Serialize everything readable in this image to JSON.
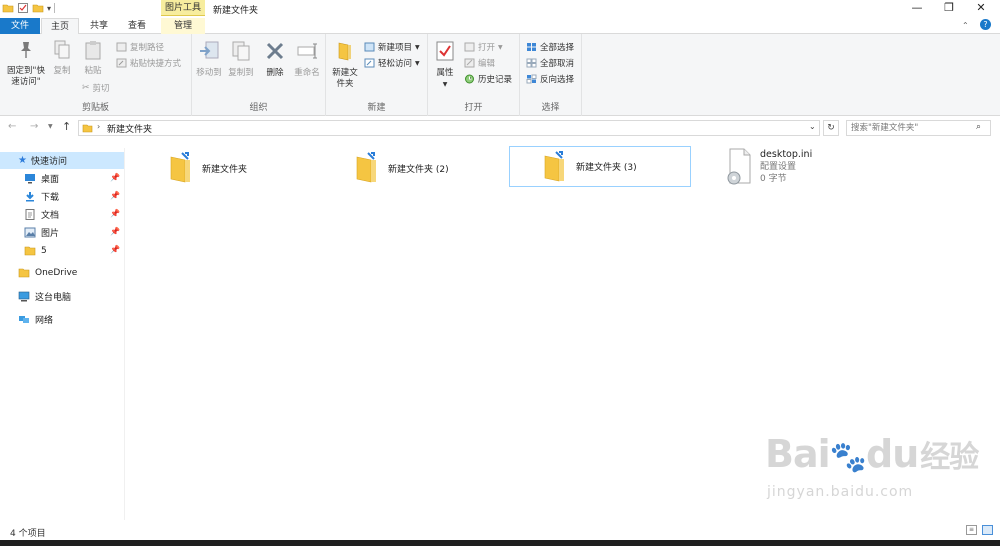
{
  "window": {
    "title": "新建文件夹",
    "contextual_tab": "图片工具"
  },
  "tabs": {
    "file": "文件",
    "home": "主页",
    "share": "共享",
    "view": "查看",
    "manage": "管理"
  },
  "ribbon": {
    "clipboard": {
      "label": "剪贴板",
      "pin": "固定到\"快速访问\"",
      "copy": "复制",
      "paste": "粘贴",
      "copy_path": "复制路径",
      "paste_shortcut": "粘贴快捷方式",
      "cut": "剪切"
    },
    "organize": {
      "label": "组织",
      "move_to": "移动到",
      "copy_to": "复制到",
      "delete": "删除",
      "rename": "重命名"
    },
    "new": {
      "label": "新建",
      "new_folder": "新建文件夹",
      "new_item": "新建项目",
      "easy_access": "轻松访问"
    },
    "open": {
      "label": "打开",
      "properties": "属性",
      "open": "打开",
      "edit": "编辑",
      "history": "历史记录"
    },
    "select": {
      "label": "选择",
      "select_all": "全部选择",
      "select_none": "全部取消",
      "invert": "反向选择"
    }
  },
  "address": {
    "path": "新建文件夹",
    "search_placeholder": "搜索\"新建文件夹\""
  },
  "nav": {
    "quick_access": "快速访问",
    "desktop": "桌面",
    "downloads": "下载",
    "documents": "文档",
    "pictures": "图片",
    "five": "5",
    "onedrive": "OneDrive",
    "this_pc": "这台电脑",
    "network": "网络"
  },
  "files": [
    {
      "name": "新建文件夹"
    },
    {
      "name": "新建文件夹 (2)"
    },
    {
      "name": "新建文件夹 (3)"
    },
    {
      "name": "desktop.ini",
      "type": "配置设置",
      "size": "0 字节"
    }
  ],
  "status": {
    "count": "4 个项目"
  },
  "watermark": {
    "brand_a": "Bai",
    "brand_b": "du",
    "brand_cn": "经验",
    "url": "jingyan.baidu.com"
  },
  "colors": {
    "accent": "#1979ca",
    "folder": "#f5c542",
    "selected_border": "#99d1ff",
    "contextual": "#f7ed9e"
  }
}
